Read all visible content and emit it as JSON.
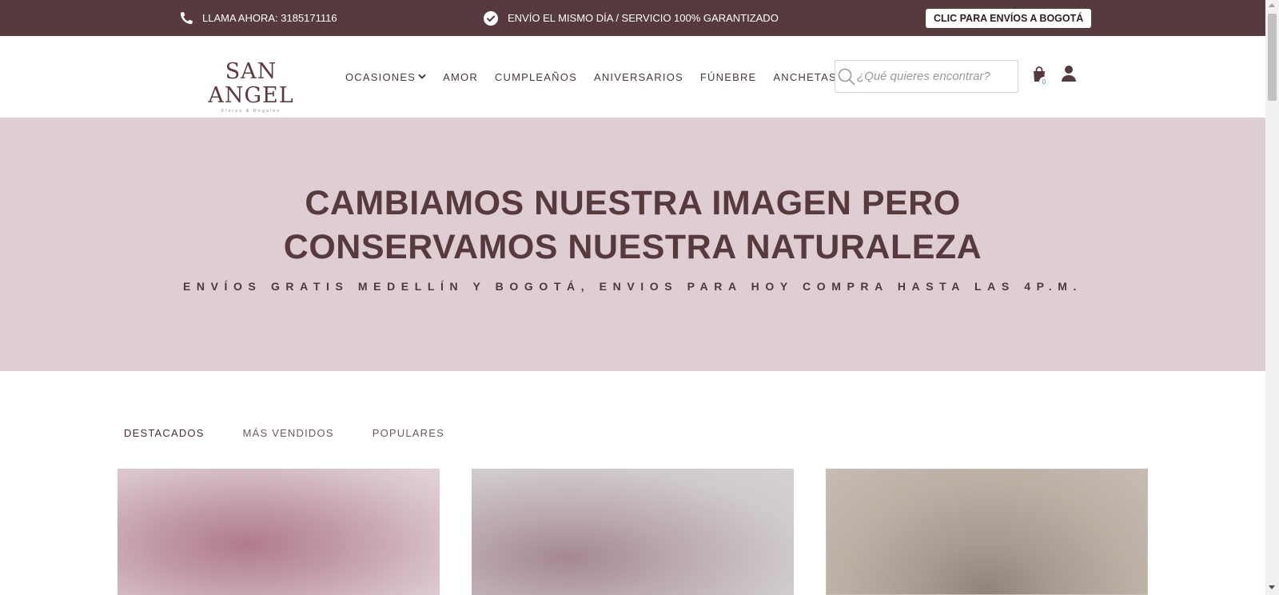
{
  "topbar": {
    "phone_text": "LLAMA AHORA: 3185171116",
    "promo_text": "ENVÍO EL MISMO DÍA / SERVICIO 100% GARANTIZADO",
    "bogota_button": "CLIC PARA ENVÍOS A BOGOTÁ",
    "phone_icon": "phone-icon",
    "promo_icon": "check-circle-icon"
  },
  "header": {
    "logo_name": "SAN ANGEL",
    "logo_tagline": "Flores & Regalos",
    "nav": [
      {
        "label": "OCASIONES",
        "has_dropdown": true
      },
      {
        "label": "AMOR"
      },
      {
        "label": "CUMPLEAÑOS"
      },
      {
        "label": "ANIVERSARIOS"
      },
      {
        "label": "FÚNEBRE"
      },
      {
        "label": "ANCHETAS"
      }
    ],
    "search_placeholder": "¿Qué quieres encontrar?",
    "cart_count": "0"
  },
  "hero": {
    "title_line1": "CAMBIAMOS NUESTRA IMAGEN PERO",
    "title_line2": "CONSERVAMOS NUESTRA NATURALEZA",
    "subtitle": "ENVÍOS GRATIS MEDELLÍN Y BOGOTÁ, ENVIOS PARA HOY COMPRA HASTA LAS 4P.M."
  },
  "tabs": [
    {
      "label": "DESTACADOS",
      "active": true
    },
    {
      "label": "MÁS VENDIDOS",
      "active": false
    },
    {
      "label": "POPULARES",
      "active": false
    }
  ],
  "colors": {
    "brand": "#573a3d",
    "hero_bg": "#decdd3"
  }
}
